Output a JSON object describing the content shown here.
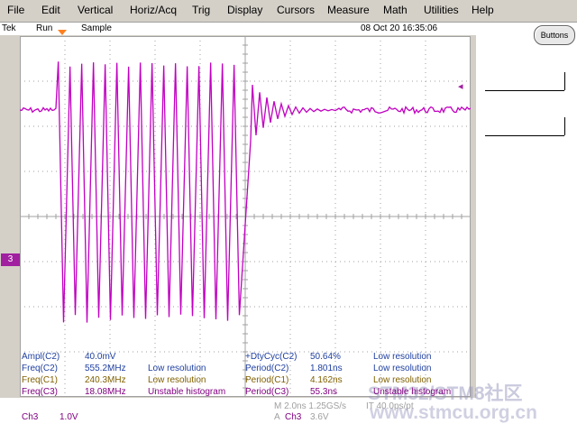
{
  "menu": [
    "File",
    "Edit",
    "Vertical",
    "Horiz/Acq",
    "Trig",
    "Display",
    "Cursors",
    "Measure",
    "Math",
    "Utilities",
    "Help"
  ],
  "status": {
    "brand": "Tek",
    "run": "Run",
    "mode": "Sample",
    "datetime": "08 Oct 20 16:35:06"
  },
  "buttons_label": "Buttons",
  "channel_marker": "3",
  "measurements": {
    "left": [
      {
        "label": "Ampl(C2)",
        "value": "40.0mV",
        "note": "",
        "color": "#2040a0"
      },
      {
        "label": "Freq(C2)",
        "value": "555.2MHz",
        "note": "Low resolution",
        "color": "#2040a0"
      },
      {
        "label": "Freq(C1)",
        "value": "240.3MHz",
        "note": "Low resolution",
        "color": "#806000"
      },
      {
        "label": "Freq(C3)",
        "value": "18.08MHz",
        "note": "Unstable histogram",
        "color": "#800080"
      }
    ],
    "right": [
      {
        "label": "+DtyCyc(C2)",
        "value": "50.64%",
        "note": "Low resolution",
        "color": "#2040a0"
      },
      {
        "label": "Period(C2)",
        "value": "1.801ns",
        "note": "Low resolution",
        "color": "#2040a0"
      },
      {
        "label": "Period(C1)",
        "value": "4.162ns",
        "note": "Low resolution",
        "color": "#806000"
      },
      {
        "label": "Period(C3)",
        "value": "55.3ns",
        "note": "Unstable histogram",
        "color": "#800080"
      }
    ]
  },
  "footer": {
    "ch": "Ch3",
    "scale": "1.0V",
    "timebase": "M 2.0ns 1.25GS/s",
    "trig_src": "Ch3",
    "trig_level": "3.6V",
    "aux": "IT 40.0ps/pt"
  },
  "watermark": {
    "line1": "STM32/STM8社区",
    "line2": "www.stmcu.org.cn"
  },
  "colors": {
    "trace": "#c000c0",
    "grid": "#a0a0a0",
    "marker": "#a020a0"
  }
}
